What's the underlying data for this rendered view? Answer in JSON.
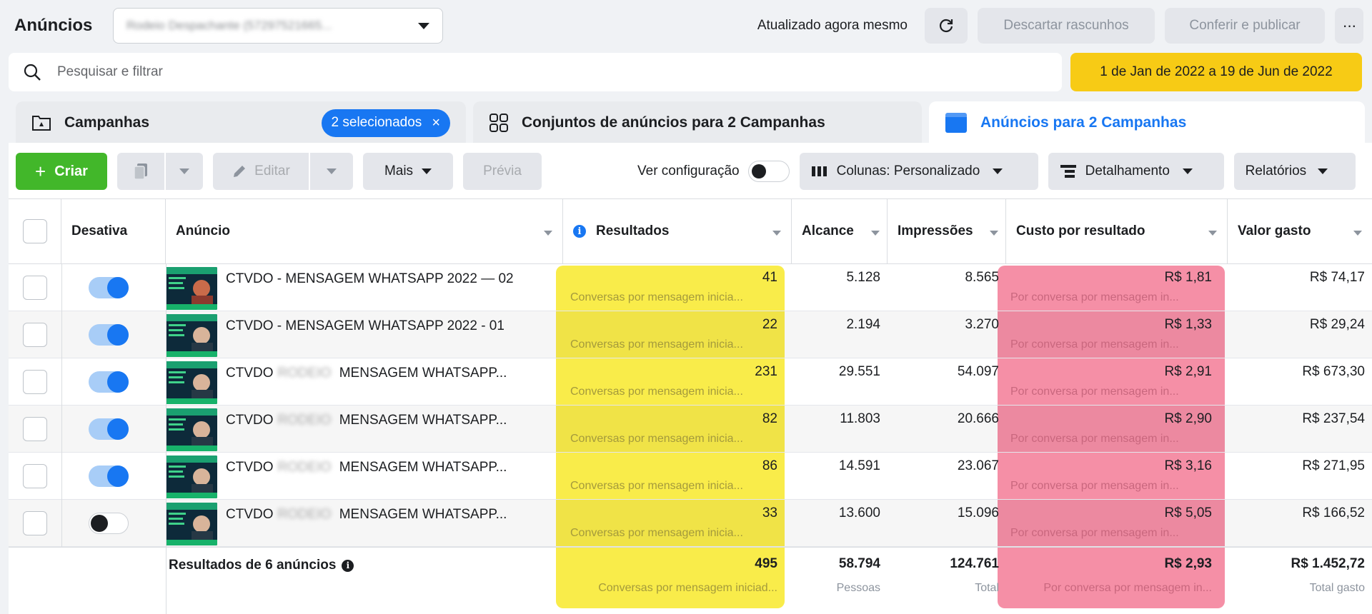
{
  "header": {
    "title": "Anúncios",
    "account_name": "Rodeio Despachante (57297521665...",
    "updated_text": "Atualizado agora mesmo",
    "discard_label": "Descartar rascunhos",
    "publish_label": "Conferir e publicar",
    "more_label": "···"
  },
  "search": {
    "placeholder": "Pesquisar e filtrar",
    "date_range": "1 de Jan de 2022 a 19 de Jun de 2022"
  },
  "tabs": {
    "campaigns": "Campanhas",
    "selected_pill": "2 selecionados",
    "pill_close": "×",
    "adsets": "Conjuntos de anúncios para 2 Campanhas",
    "ads": "Anúncios para 2 Campanhas"
  },
  "toolbar": {
    "create": "Criar",
    "create_plus": "+",
    "edit": "Editar",
    "more": "Mais",
    "preview": "Prévia",
    "view_config": "Ver configuração",
    "columns": "Colunas: Personalizado",
    "breakdown": "Detalhamento",
    "reports": "Relatórios"
  },
  "columns": {
    "toggle": "Desativa",
    "ad": "Anúncio",
    "results": "Resultados",
    "reach": "Alcance",
    "impressions": "Impressões",
    "cost_per_result": "Custo por resultado",
    "amount_spent": "Valor gasto"
  },
  "rows": [
    {
      "name_prefix": "CTVDO - MENSAGEM WHATSAPP 2022 — 02",
      "name_hidden": "",
      "name_suffix": "",
      "active": true,
      "results": "41",
      "results_sub": "Conversas por mensagem inicia...",
      "reach": "5.128",
      "impressions": "8.565",
      "cost": "R$ 1,81",
      "cost_sub": "Por conversa por mensagem in...",
      "spent": "R$ 74,17"
    },
    {
      "name_prefix": "CTVDO - MENSAGEM WHATSAPP 2022 - 01",
      "name_hidden": "",
      "name_suffix": "",
      "active": true,
      "results": "22",
      "results_sub": "Conversas por mensagem inicia...",
      "reach": "2.194",
      "impressions": "3.270",
      "cost": "R$ 1,33",
      "cost_sub": "Por conversa por mensagem in...",
      "spent": "R$ 29,24"
    },
    {
      "name_prefix": "CTVDO",
      "name_hidden": "RODEIO",
      "name_suffix": "MENSAGEM WHATSAPP...",
      "active": true,
      "results": "231",
      "results_sub": "Conversas por mensagem inicia...",
      "reach": "29.551",
      "impressions": "54.097",
      "cost": "R$ 2,91",
      "cost_sub": "Por conversa por mensagem in...",
      "spent": "R$ 673,30"
    },
    {
      "name_prefix": "CTVDO",
      "name_hidden": "RODEIO",
      "name_suffix": "MENSAGEM WHATSAPP...",
      "active": true,
      "results": "82",
      "results_sub": "Conversas por mensagem inicia...",
      "reach": "11.803",
      "impressions": "20.666",
      "cost": "R$ 2,90",
      "cost_sub": "Por conversa por mensagem in...",
      "spent": "R$ 237,54"
    },
    {
      "name_prefix": "CTVDO",
      "name_hidden": "RODEIO",
      "name_suffix": "MENSAGEM WHATSAPP...",
      "active": true,
      "results": "86",
      "results_sub": "Conversas por mensagem inicia...",
      "reach": "14.591",
      "impressions": "23.067",
      "cost": "R$ 3,16",
      "cost_sub": "Por conversa por mensagem in...",
      "spent": "R$ 271,95"
    },
    {
      "name_prefix": "CTVDO",
      "name_hidden": "RODEIO",
      "name_suffix": "MENSAGEM WHATSAPP...",
      "active": false,
      "results": "33",
      "results_sub": "Conversas por mensagem inicia...",
      "reach": "13.600",
      "impressions": "15.096",
      "cost": "R$ 5,05",
      "cost_sub": "Por conversa por mensagem in...",
      "spent": "R$ 166,52"
    }
  ],
  "totals": {
    "label": "Resultados de 6 anúncios",
    "results": "495",
    "results_sub": "Conversas por mensagem iniciad...",
    "reach": "58.794",
    "reach_sub": "Pessoas",
    "impressions": "124.761",
    "impressions_sub": "Total",
    "cost": "R$ 2,93",
    "cost_sub": "Por conversa por mensagem in...",
    "spent": "R$ 1.452,72",
    "spent_sub": "Total gasto"
  },
  "colors": {
    "accent": "#1877f2",
    "create": "#42b72a",
    "date_highlight": "#f7cb15",
    "results_highlight": "#f9ec4a",
    "cost_highlight": "#f58fa6"
  },
  "icons": [
    "refresh-icon",
    "search-icon",
    "campaign-icon",
    "adsets-icon",
    "ads-icon",
    "duplicate-icon",
    "pencil-icon",
    "columns-icon",
    "breakdown-icon",
    "info-icon"
  ]
}
